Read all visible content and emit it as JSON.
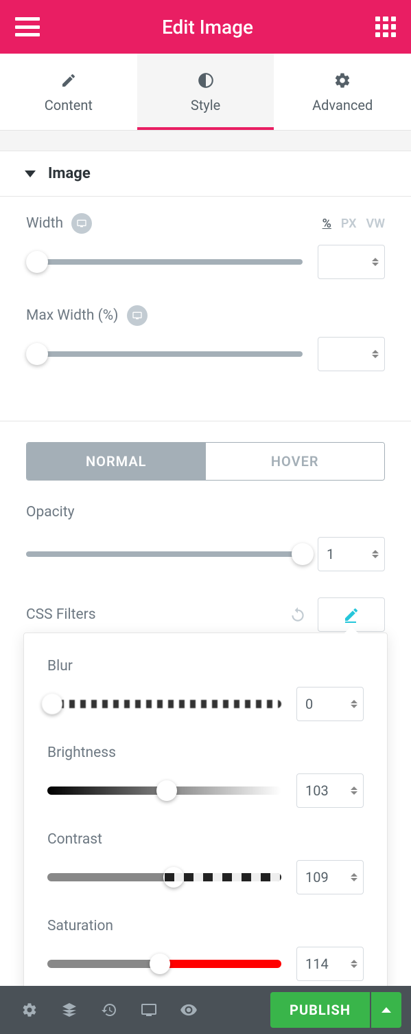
{
  "header": {
    "title": "Edit Image"
  },
  "tabs": {
    "content": "Content",
    "style": "Style",
    "advanced": "Advanced"
  },
  "section": {
    "image": "Image"
  },
  "width": {
    "label": "Width",
    "units": {
      "percent": "%",
      "px": "PX",
      "vw": "VW"
    },
    "value": ""
  },
  "maxwidth": {
    "label": "Max Width (%)",
    "value": ""
  },
  "state": {
    "normal": "NORMAL",
    "hover": "HOVER"
  },
  "opacity": {
    "label": "Opacity",
    "value": "1"
  },
  "filters": {
    "label": "CSS Filters"
  },
  "filter": {
    "blur": {
      "label": "Blur",
      "value": "0"
    },
    "brightness": {
      "label": "Brightness",
      "value": "103"
    },
    "contrast": {
      "label": "Contrast",
      "value": "109"
    },
    "saturation": {
      "label": "Saturation",
      "value": "114"
    }
  },
  "footer": {
    "publish": "PUBLISH"
  }
}
